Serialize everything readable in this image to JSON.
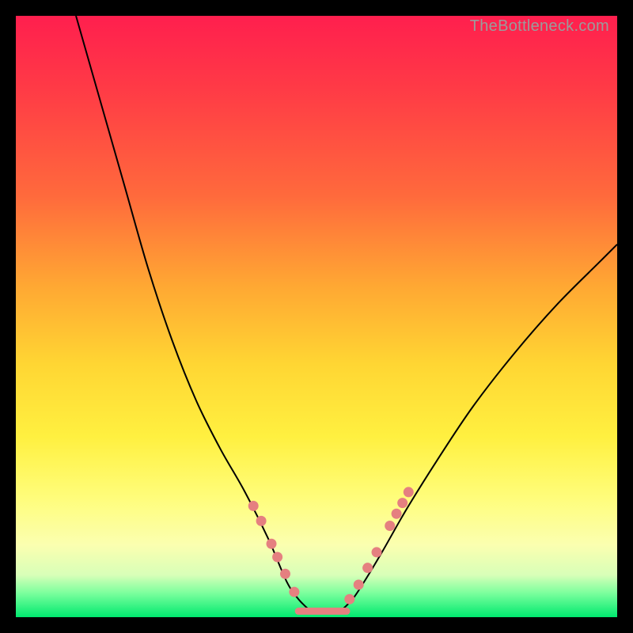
{
  "attribution": "TheBottleneck.com",
  "colors": {
    "frame_bg": "#000000",
    "gradient_top": "#ff1f4e",
    "gradient_mid1": "#ffa833",
    "gradient_mid2": "#fff040",
    "gradient_bottom": "#00e96f",
    "curve_stroke": "#000000",
    "dot_fill": "#e58080"
  },
  "chart_data": {
    "type": "line",
    "title": "",
    "xlabel": "",
    "ylabel": "",
    "xlim": [
      0,
      100
    ],
    "ylim": [
      0,
      100
    ],
    "series": [
      {
        "name": "left-descending-curve",
        "x": [
          10,
          14,
          18,
          22,
          26,
          30,
          34,
          38,
          42,
          45,
          47,
          49
        ],
        "y": [
          100,
          86,
          72,
          58,
          46,
          36,
          28,
          21,
          13,
          6,
          3,
          1
        ]
      },
      {
        "name": "right-ascending-curve",
        "x": [
          54,
          56,
          58,
          61,
          65,
          70,
          76,
          83,
          90,
          97,
          100
        ],
        "y": [
          1,
          3,
          6,
          11,
          18,
          26,
          35,
          44,
          52,
          59,
          62
        ]
      },
      {
        "name": "valley-flat-segment",
        "x": [
          47,
          55
        ],
        "y": [
          1,
          1
        ]
      }
    ],
    "annotations": {
      "left_dots_xy": [
        [
          39.5,
          18.5
        ],
        [
          40.8,
          16.0
        ],
        [
          42.5,
          12.2
        ],
        [
          43.5,
          10.0
        ],
        [
          44.8,
          7.2
        ],
        [
          46.3,
          4.2
        ]
      ],
      "right_dots_xy": [
        [
          55.5,
          3.0
        ],
        [
          57.0,
          5.4
        ],
        [
          58.5,
          8.2
        ],
        [
          60.0,
          10.8
        ],
        [
          62.2,
          15.2
        ],
        [
          63.3,
          17.2
        ],
        [
          64.3,
          19.0
        ],
        [
          65.3,
          20.8
        ]
      ]
    }
  }
}
